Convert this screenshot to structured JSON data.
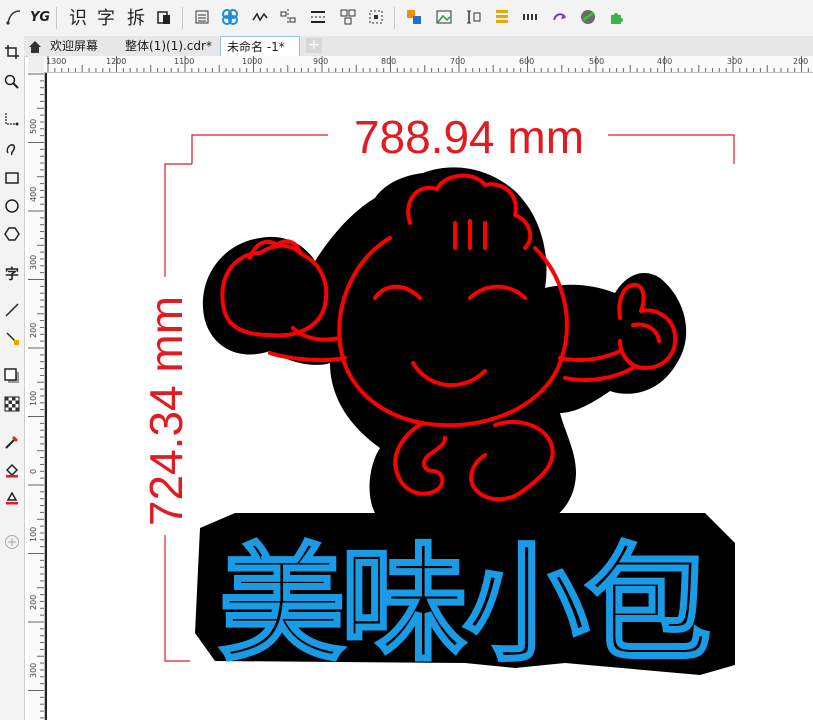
{
  "toolbar": {
    "items": [
      "curve-tool-icon",
      "yg-plugin",
      "识",
      "字",
      "拆",
      "clipboard-icon",
      "list-icon",
      "pattern-icon",
      "node-icon",
      "align-icon",
      "distribute-icon",
      "arrange-icon",
      "select-icon",
      "color-icon",
      "image-icon",
      "text-align-icon",
      "layout-icon",
      "grid-icon",
      "arrow-icon",
      "globe-icon",
      "puzzle-icon"
    ],
    "yg_label": "YG",
    "shi_label": "识",
    "zi_label": "字",
    "chai_label": "拆"
  },
  "tabs": [
    {
      "label": "欢迎屏幕"
    },
    {
      "label": "整体(1)(1).cdr*"
    },
    {
      "label": "未命名 -1*"
    }
  ],
  "ruler_h": [
    "1300",
    "1200",
    "1100",
    "1000",
    "900",
    "800",
    "700",
    "600",
    "500",
    "400",
    "300",
    "200"
  ],
  "ruler_v": [
    "500",
    "400",
    "300",
    "200",
    "100",
    "0",
    "100",
    "200",
    "300"
  ],
  "canvas": {
    "width_dim": "788.94 mm",
    "height_dim": "724.34 mm",
    "title_text": "美味小包",
    "dim_color": "#e01b22",
    "neon_red": "#ff0000",
    "neon_blue": "#1a9be6",
    "backing": "#000000"
  }
}
